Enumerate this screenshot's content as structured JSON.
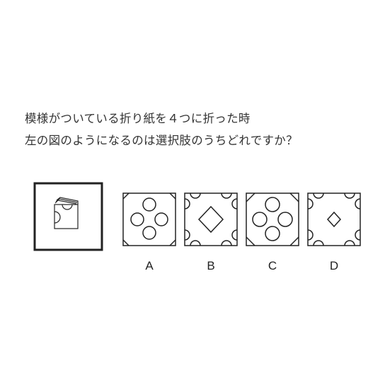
{
  "question": {
    "line1": "模様がついている折り紙を４つに折った時",
    "line2": "左の図のようになるのは選択肢のうちどれですか？"
  },
  "reference": {
    "icon": "folded-paper-icon"
  },
  "options": [
    {
      "label": "A",
      "icon": "option-a-pattern-icon"
    },
    {
      "label": "B",
      "icon": "option-b-pattern-icon"
    },
    {
      "label": "C",
      "icon": "option-c-pattern-icon"
    },
    {
      "label": "D",
      "icon": "option-d-pattern-icon"
    }
  ],
  "colors": {
    "stroke": "#222222",
    "text": "#333333",
    "background": "#ffffff"
  }
}
